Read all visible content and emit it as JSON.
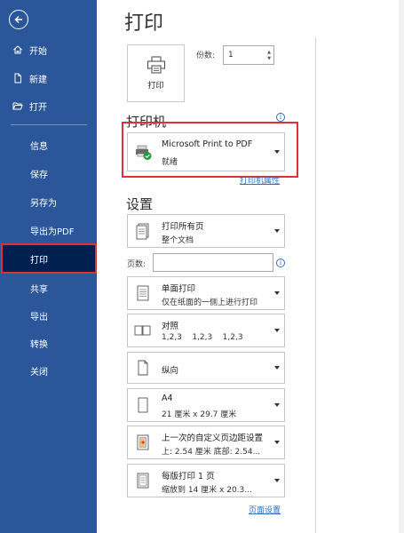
{
  "sidebar": {
    "items": [
      {
        "label": "开始",
        "icon": "home-icon"
      },
      {
        "label": "新建",
        "icon": "new-doc-icon"
      },
      {
        "label": "打开",
        "icon": "folder-open-icon"
      },
      {
        "label": "信息"
      },
      {
        "label": "保存"
      },
      {
        "label": "另存为"
      },
      {
        "label": "导出为PDF"
      },
      {
        "label": "打印",
        "active": true
      },
      {
        "label": "共享"
      },
      {
        "label": "导出"
      },
      {
        "label": "转换"
      },
      {
        "label": "关闭"
      }
    ]
  },
  "page": {
    "title": "打印"
  },
  "print_button": {
    "label": "打印"
  },
  "copies": {
    "label": "份数:",
    "value": "1"
  },
  "printer": {
    "heading": "打印机",
    "name": "Microsoft Print to PDF",
    "status": "就绪",
    "properties_link": "打印机属性"
  },
  "settings": {
    "heading": "设置",
    "print_range": {
      "line1": "打印所有页",
      "line2": "整个文档"
    },
    "pages_label": "页数:",
    "sides": {
      "line1": "单面打印",
      "line2": "仅在纸面的一侧上进行打印"
    },
    "collate": {
      "line1": "对照",
      "line2": "1,2,3    1,2,3    1,2,3"
    },
    "orientation": {
      "line1": "纵向"
    },
    "paper": {
      "line1": "A4",
      "line2": "21 厘米 x 29.7 厘米"
    },
    "margins": {
      "line1": "上一次的自定义页边距设置",
      "line2": "上: 2.54 厘米 底部: 2.54..."
    },
    "pages_per_sheet": {
      "line1": "每版打印 1 页",
      "line2": "缩放到 14 厘米 x 20.3..."
    },
    "page_setup_link": "页面设置"
  },
  "colors": {
    "sidebar": "#2b579a",
    "active": "#002050",
    "highlight": "#e0302f",
    "link": "#2b6ec4"
  }
}
